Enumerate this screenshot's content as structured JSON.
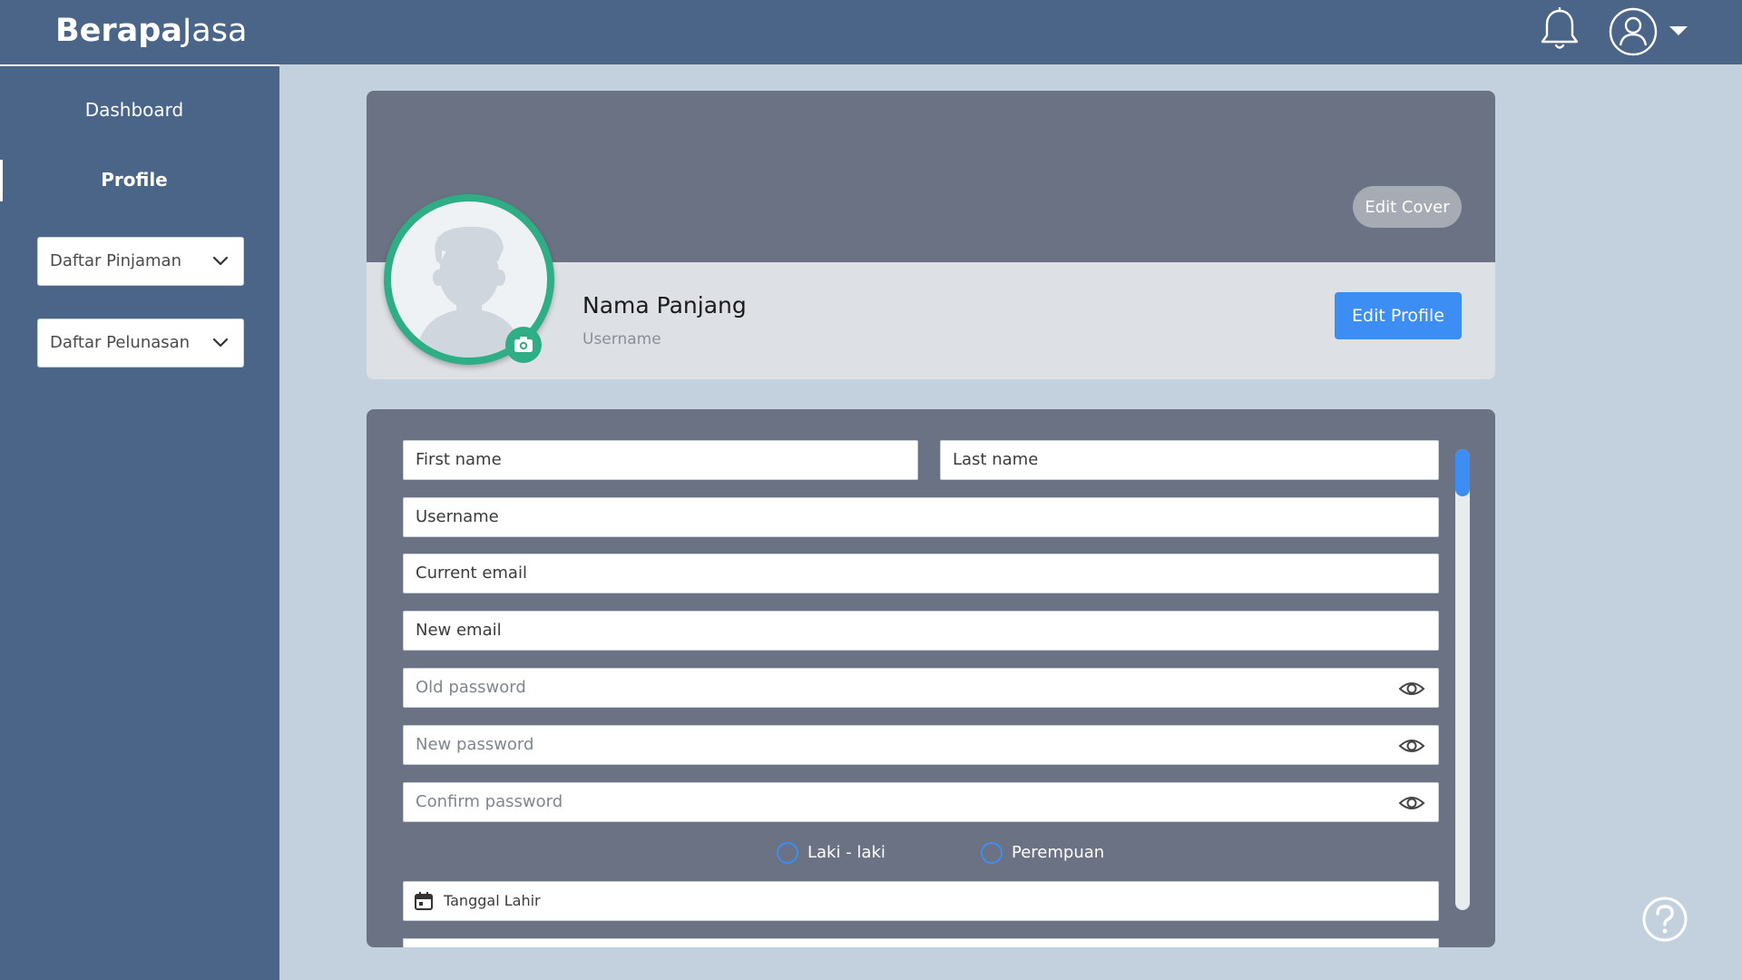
{
  "brand": {
    "bold": "Berapa",
    "regular": "Jasa"
  },
  "header": {
    "notifications_icon": "bell-icon",
    "account_icon": "user-circle-icon",
    "menu_icon": "caret-down-icon"
  },
  "sidebar": {
    "items": [
      {
        "label": "Dashboard",
        "active": false
      },
      {
        "label": "Profile",
        "active": true
      }
    ],
    "dropdowns": [
      {
        "label": "Daftar Pinjaman",
        "icon": "chevron-down-icon"
      },
      {
        "label": "Daftar Pelunasan",
        "icon": "chevron-down-icon"
      }
    ]
  },
  "profile": {
    "edit_cover_label": "Edit Cover",
    "name": "Nama Panjang",
    "username": "Username",
    "edit_profile_label": "Edit Profile",
    "avatar_icon": "user-silhouette-icon",
    "camera_icon": "camera-icon"
  },
  "form": {
    "first_name": "First name",
    "last_name": "Last name",
    "username": "Username",
    "current_email": "Current email",
    "new_email": "New email",
    "old_password": "Old password",
    "new_password": "New password",
    "confirm_password": "Confirm password",
    "gender_options": [
      "Laki - laki",
      "Perempuan"
    ],
    "birth_date": "Tanggal Lahir",
    "password_toggle_icon": "eye-icon",
    "date_icon": "calendar-icon"
  },
  "help_icon": "help-icon",
  "colors": {
    "primary": "#4a6588",
    "accent": "#3c8ef4",
    "avatar_ring": "#2fae86",
    "cover": "#6b7283",
    "background": "#c2d1dd"
  }
}
